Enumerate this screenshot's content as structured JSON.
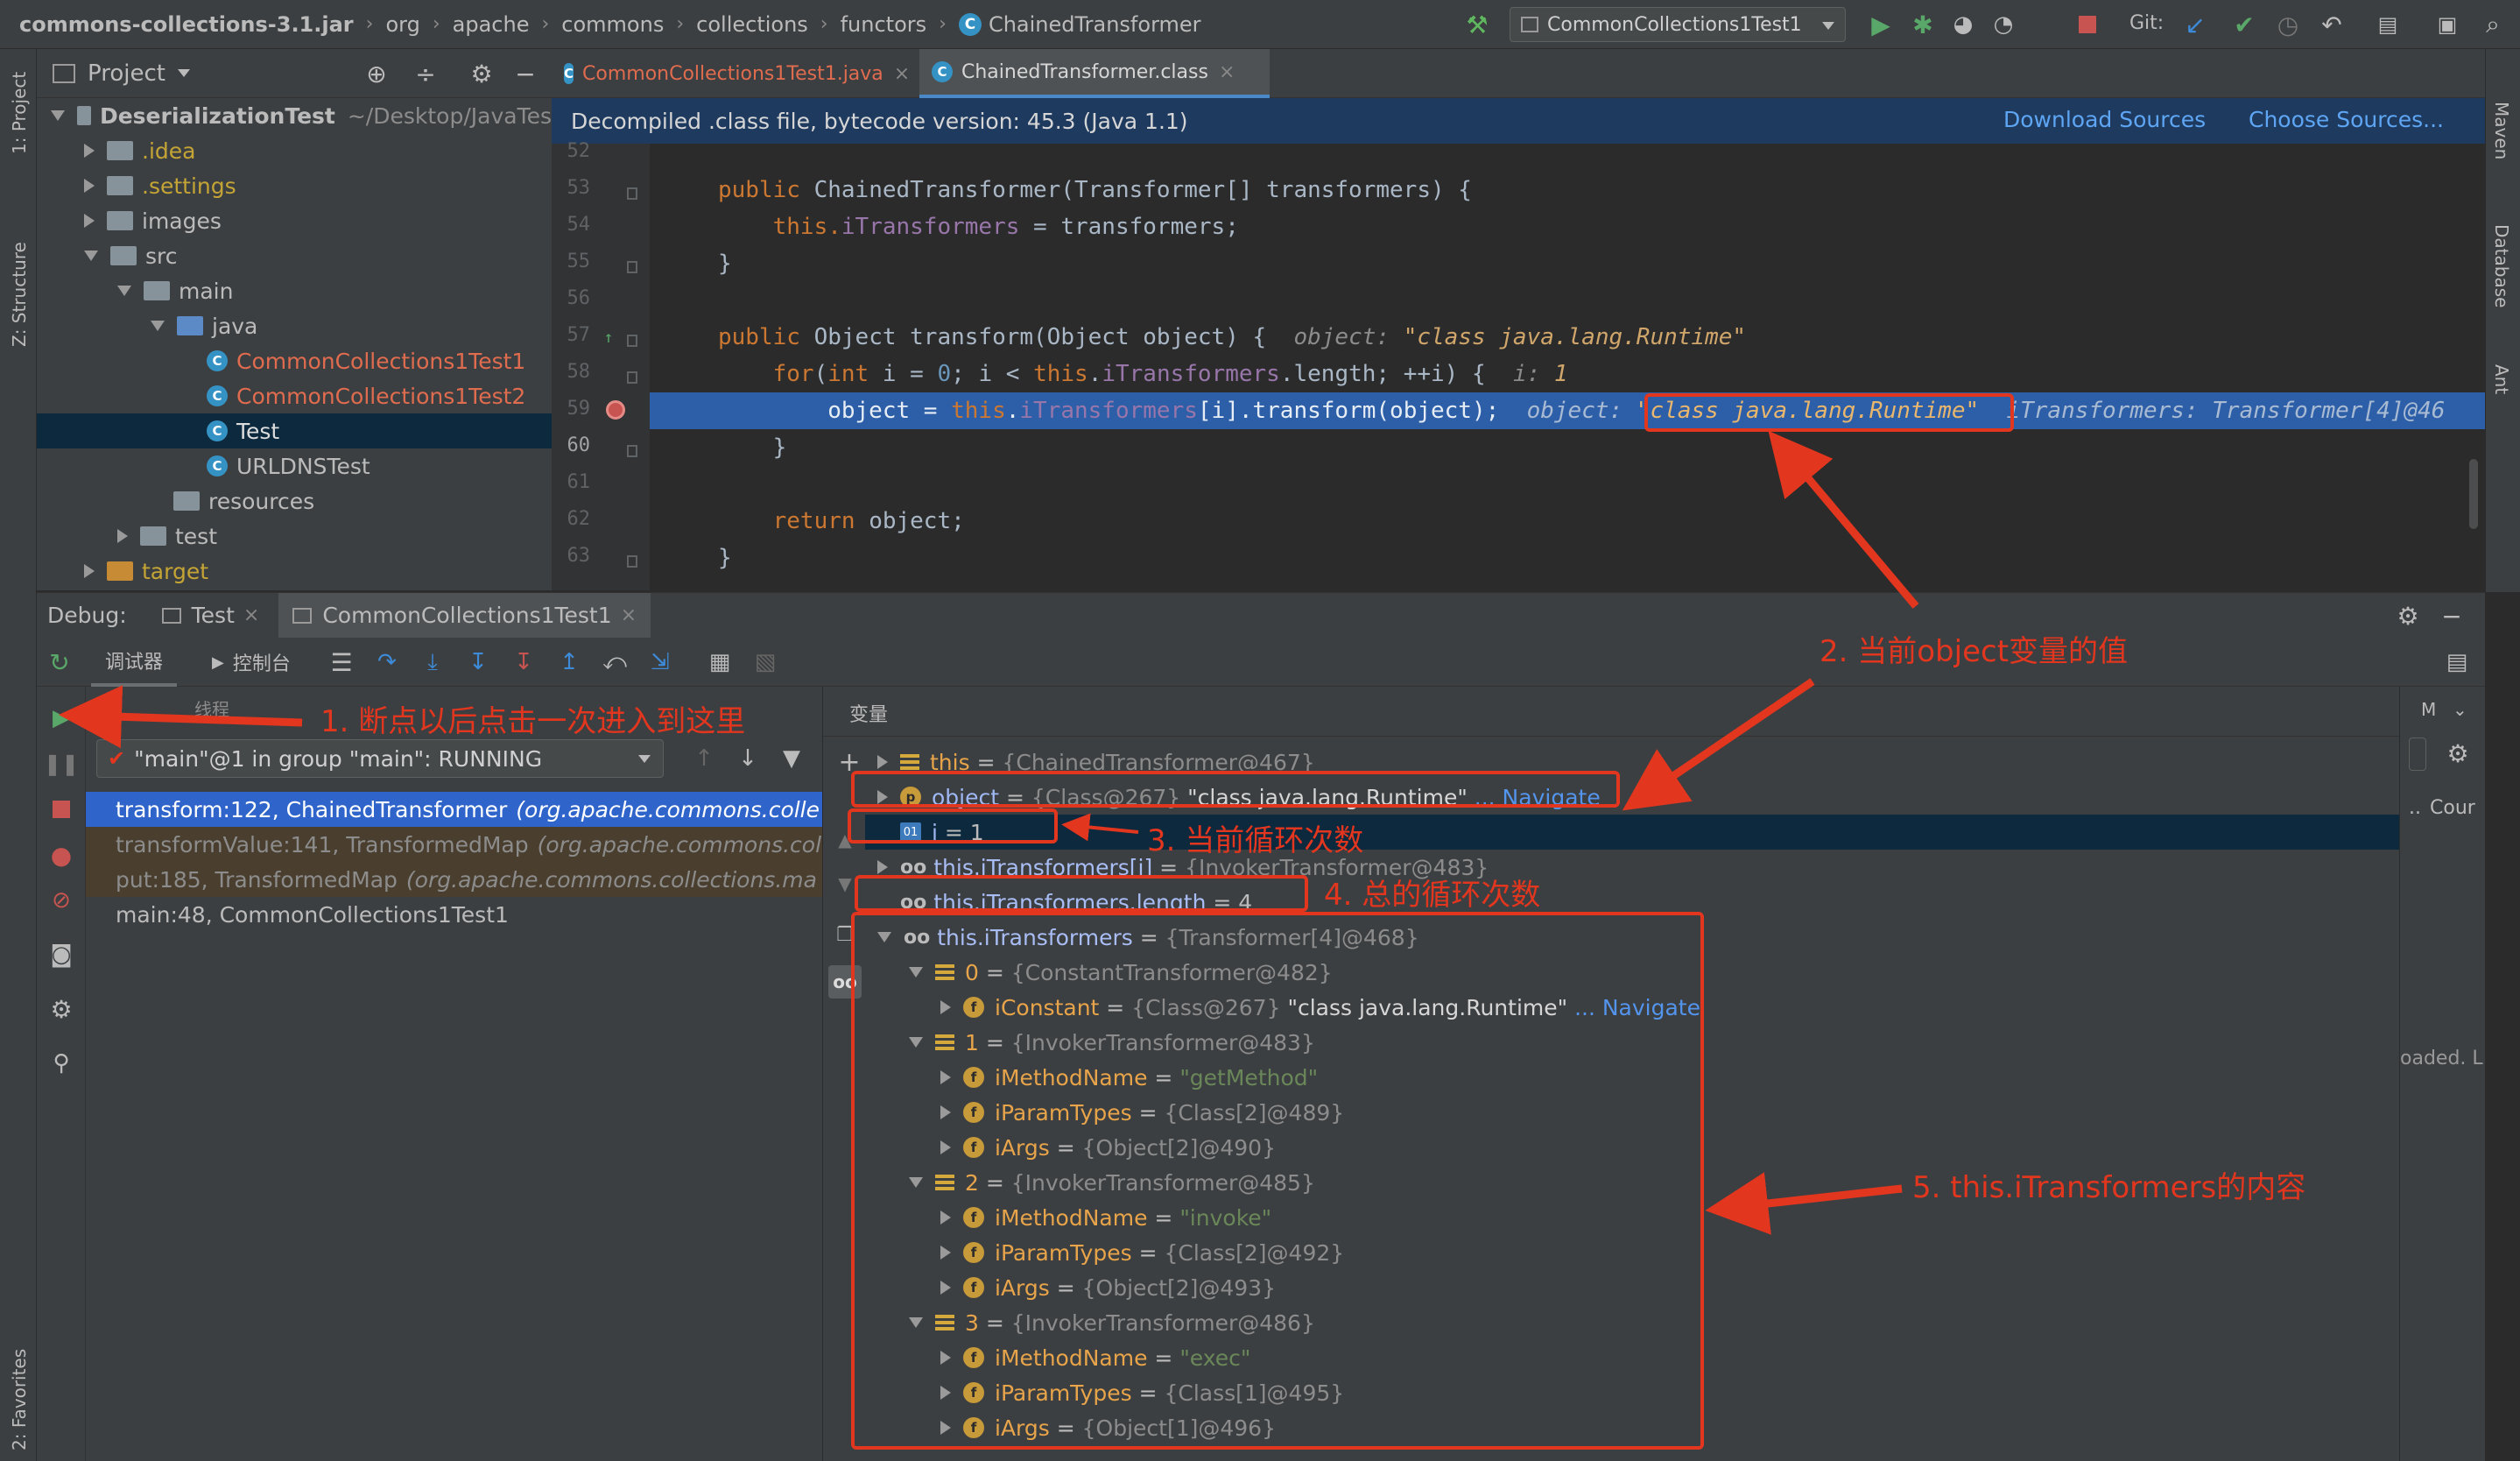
{
  "breadcrumb": {
    "items": [
      "commons-collections-3.1.jar",
      "org",
      "apache",
      "commons",
      "collections",
      "functors"
    ],
    "current": "ChainedTransformer"
  },
  "toolbar": {
    "run_config": "CommonCollections1Test1",
    "git_label": "Git:"
  },
  "left_strip": {
    "project": "1: Project",
    "structure": "Z: Structure",
    "favorites": "2: Favorites"
  },
  "right_strip": {
    "maven": "Maven",
    "database": "Database",
    "ant": "Ant"
  },
  "project": {
    "title": "Project",
    "tree": [
      {
        "label": "DeserializationTest",
        "suffix": "~/Desktop/JavaTes",
        "depth": 0,
        "expanded": true,
        "kind": "module"
      },
      {
        "label": ".idea",
        "depth": 1,
        "expanded": false,
        "kind": "folder",
        "color": "#c5a436"
      },
      {
        "label": ".settings",
        "depth": 1,
        "expanded": false,
        "kind": "folder",
        "color": "#c5a436"
      },
      {
        "label": "images",
        "depth": 1,
        "expanded": false,
        "kind": "folder"
      },
      {
        "label": "src",
        "depth": 1,
        "expanded": true,
        "kind": "folder"
      },
      {
        "label": "main",
        "depth": 2,
        "expanded": true,
        "kind": "folder"
      },
      {
        "label": "java",
        "depth": 3,
        "expanded": true,
        "kind": "source"
      },
      {
        "label": "CommonCollections1Test1",
        "depth": 4,
        "kind": "class",
        "color": "#e06c4f"
      },
      {
        "label": "CommonCollections1Test2",
        "depth": 4,
        "kind": "class",
        "color": "#e06c4f"
      },
      {
        "label": "Test",
        "depth": 4,
        "kind": "class",
        "selected": true
      },
      {
        "label": "URLDNSTest",
        "depth": 4,
        "kind": "class"
      },
      {
        "label": "resources",
        "depth": 3,
        "kind": "folder"
      },
      {
        "label": "test",
        "depth": 2,
        "expanded": false,
        "kind": "folder"
      },
      {
        "label": "target",
        "depth": 1,
        "expanded": false,
        "kind": "target",
        "color": "#c5a436"
      }
    ]
  },
  "editor": {
    "tabs": [
      {
        "label": "CommonCollections1Test1.java",
        "active": false
      },
      {
        "label": "ChainedTransformer.class",
        "active": true
      }
    ],
    "banner": {
      "text": "Decompiled .class file, bytecode version: 45.3 (Java 1.1)",
      "download": "Download Sources",
      "choose": "Choose Sources..."
    },
    "line_numbers": [
      "52",
      "53",
      "54",
      "55",
      "56",
      "57",
      "58",
      "59",
      "60",
      "61",
      "62",
      "63"
    ],
    "lines": {
      "l53a": "public ",
      "l53b": "ChainedTransformer(Transformer[] transformers) {",
      "l54a": "    this.",
      "l54b": "iTransformers",
      "l54c": " = transformers;",
      "l55": "}",
      "l57a": "public ",
      "l57b": "Object transform(Object object) {  ",
      "l57h": "object: ",
      "l57s": "\"class java.lang.Runtime\"",
      "l58a": "    for",
      "l58b": "(",
      "l58c": "int ",
      "l58d": "i = ",
      "l58e": "0",
      "l58f": "; i < ",
      "l58g": "this",
      "l58h": ".",
      "l58i": "iTransformers",
      "l58j": ".length; ++i) {  ",
      "l58k": "i: ",
      "l58l": "1",
      "l59a": "        object = ",
      "l59b": "this",
      "l59c": ".",
      "l59d": "iTransformers",
      "l59e": "[i].transform(object);  ",
      "l59h": "object: ",
      "l59s": "\"class java.lang.Runtime\"",
      "l59t": "  iTransformers: Transformer[4]@46",
      "l60": "    }",
      "l62a": "    return ",
      "l62b": "object;",
      "l63": "}"
    }
  },
  "debug": {
    "label": "Debug:",
    "tabs": [
      {
        "label": "Test",
        "active": false
      },
      {
        "label": "CommonCollections1Test1",
        "active": true
      }
    ],
    "subtabs": {
      "debugger": "调试器",
      "console": "控制台"
    },
    "frames_header": "线程",
    "vars_header": "变量",
    "thread": "\"main\"@1 in group \"main\": RUNNING",
    "frames": [
      {
        "method": "transform:122, ChainedTransformer",
        "pkg": "(org.apache.commons.colle",
        "state": "selected"
      },
      {
        "method": "transformValue:141, TransformedMap",
        "pkg": "(org.apache.commons.col",
        "state": "lib"
      },
      {
        "method": "put:185, TransformedMap",
        "pkg": "(org.apache.commons.collections.ma",
        "state": "lib"
      },
      {
        "method": "main:48, CommonCollections1Test1",
        "pkg": "",
        "state": "normal"
      }
    ],
    "variables": [
      {
        "name": "this",
        "eq": " = ",
        "value": "{ChainedTransformer@467}",
        "depth": 0,
        "tri": "r",
        "icon": "arr"
      },
      {
        "name": "object",
        "eq": " = ",
        "value": "{Class@267}",
        "str": " \"class java.lang.Runtime\"",
        "link": " ... Navigate",
        "depth": 0,
        "tri": "r",
        "icon": "p"
      },
      {
        "name": "i",
        "eq": " = ",
        "value": "1",
        "depth": 0,
        "icon": "prim",
        "selected": true
      },
      {
        "name": "this.iTransformers[i]",
        "eq": " = ",
        "value": "{InvokerTransformer@483}",
        "depth": 0,
        "tri": "r",
        "icon": "oo"
      },
      {
        "name": "this.iTransformers.length",
        "eq": " = ",
        "value": "4",
        "depth": 0,
        "icon": "oo"
      },
      {
        "name": "this.iTransformers",
        "eq": " = ",
        "value": "{Transformer[4]@468}",
        "depth": 0,
        "tri": "d",
        "icon": "oo"
      },
      {
        "name": "0",
        "eq": " = ",
        "value": "{ConstantTransformer@482}",
        "depth": 1,
        "tri": "d",
        "icon": "arr"
      },
      {
        "name": "iConstant",
        "eq": " = ",
        "value": "{Class@267}",
        "str": " \"class java.lang.Runtime\"",
        "link": " ... Navigate",
        "depth": 2,
        "tri": "r",
        "icon": "f"
      },
      {
        "name": "1",
        "eq": " = ",
        "value": "{InvokerTransformer@483}",
        "depth": 1,
        "tri": "d",
        "icon": "arr"
      },
      {
        "name": "iMethodName",
        "eq": " = ",
        "value": "",
        "str": "\"getMethod\"",
        "depth": 2,
        "tri": "r",
        "icon": "f"
      },
      {
        "name": "iParamTypes",
        "eq": " = ",
        "value": "{Class[2]@489}",
        "depth": 2,
        "tri": "r",
        "icon": "f"
      },
      {
        "name": "iArgs",
        "eq": " = ",
        "value": "{Object[2]@490}",
        "depth": 2,
        "tri": "r",
        "icon": "f"
      },
      {
        "name": "2",
        "eq": " = ",
        "value": "{InvokerTransformer@485}",
        "depth": 1,
        "tri": "d",
        "icon": "arr"
      },
      {
        "name": "iMethodName",
        "eq": " = ",
        "value": "",
        "str": "\"invoke\"",
        "depth": 2,
        "tri": "r",
        "icon": "f"
      },
      {
        "name": "iParamTypes",
        "eq": " = ",
        "value": "{Class[2]@492}",
        "depth": 2,
        "tri": "r",
        "icon": "f"
      },
      {
        "name": "iArgs",
        "eq": " = ",
        "value": "{Object[2]@493}",
        "depth": 2,
        "tri": "r",
        "icon": "f"
      },
      {
        "name": "3",
        "eq": " = ",
        "value": "{InvokerTransformer@486}",
        "depth": 1,
        "tri": "d",
        "icon": "arr"
      },
      {
        "name": "iMethodName",
        "eq": " = ",
        "value": "",
        "str": "\"exec\"",
        "depth": 2,
        "tri": "r",
        "icon": "f"
      },
      {
        "name": "iParamTypes",
        "eq": " = ",
        "value": "{Class[1]@495}",
        "depth": 2,
        "tri": "r",
        "icon": "f"
      },
      {
        "name": "iArgs",
        "eq": " = ",
        "value": "{Object[1]@496}",
        "depth": 2,
        "tri": "r",
        "icon": "f"
      }
    ],
    "watches": {
      "hdr": "M",
      "count": "Cour",
      "loaded": "oaded. L",
      "dots": ".."
    }
  },
  "annotations": {
    "a1": "1. 断点以后点击一次进入到这里",
    "a2": "2. 当前object变量的值",
    "a3": "3. 当前循环次数",
    "a4": "4. 总的循环次数",
    "a5": "5. this.iTransformers的内容"
  },
  "colors": {
    "accent_red": "#e2361f",
    "selection": "#2f65ca",
    "breakpoint_line": "#2d5fa8"
  }
}
